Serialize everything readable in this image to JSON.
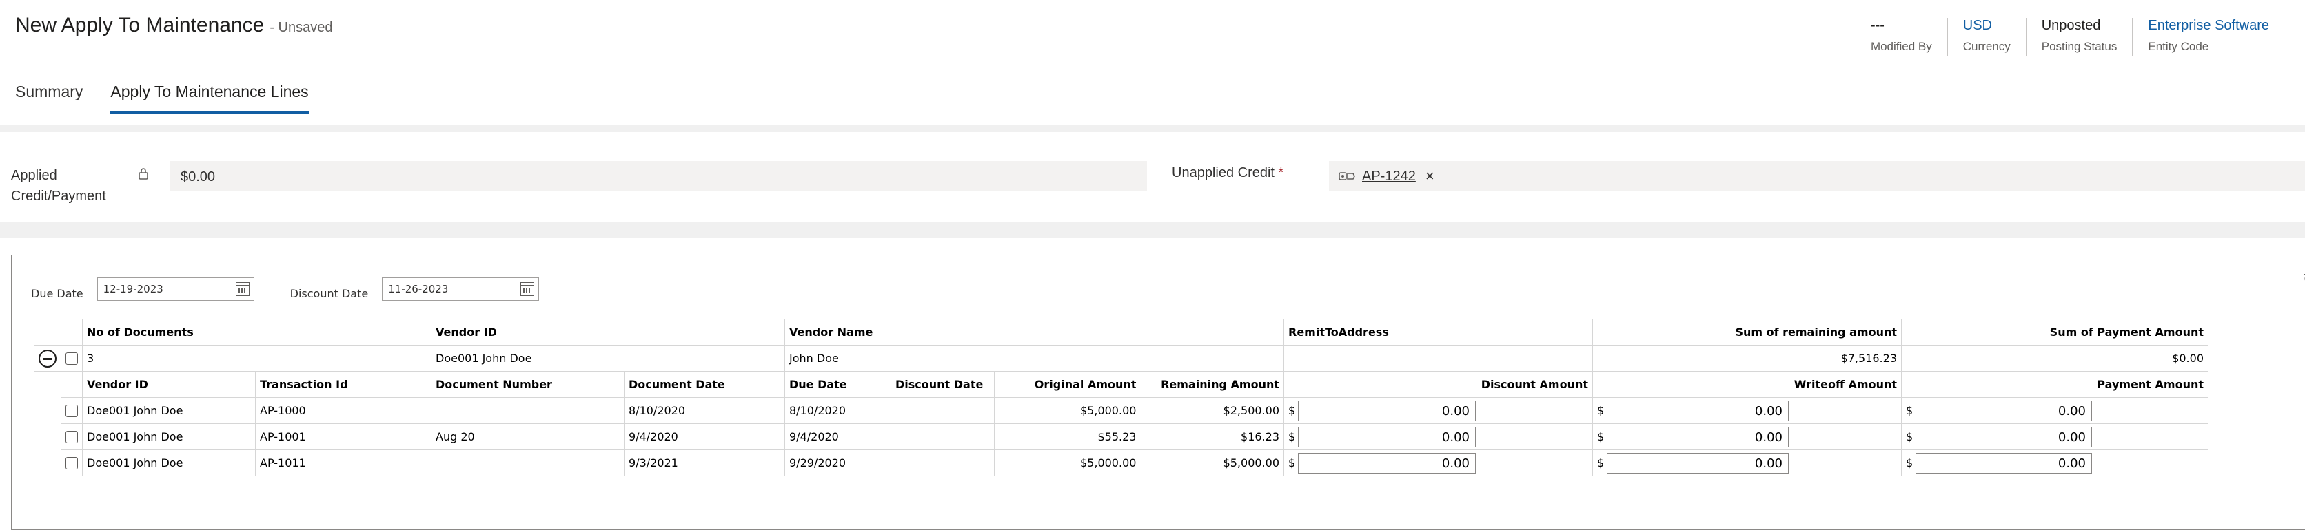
{
  "header": {
    "title": "New Apply To Maintenance",
    "status": "- Unsaved",
    "fields": [
      {
        "value": "---",
        "label": "Modified By",
        "link": false
      },
      {
        "value": "USD",
        "label": "Currency",
        "link": true
      },
      {
        "value": "Unposted",
        "label": "Posting Status",
        "link": false
      },
      {
        "value": "Enterprise Software",
        "label": "Entity Code",
        "link": true
      }
    ]
  },
  "tabs": [
    "Summary",
    "Apply To Maintenance Lines"
  ],
  "form": {
    "applied_label": "Applied Credit/Payment",
    "applied_value": "$0.00",
    "unapplied_label": "Unapplied Credit",
    "required_mark": "*",
    "unapplied_tag": "AP-1242",
    "remove_glyph": "×"
  },
  "filters": {
    "due_date_label": "Due Date",
    "due_date_value": "12-19-2023",
    "discount_date_label": "Discount Date",
    "discount_date_value": "11-26-2023"
  },
  "summary": {
    "headers": [
      "No of Documents",
      "Vendor ID",
      "Vendor Name",
      "RemitToAddress",
      "Sum of remaining amount",
      "Sum of Payment Amount"
    ],
    "row": [
      "3",
      "Doe001 John Doe",
      "John Doe",
      "",
      "$7,516.23",
      "$0.00"
    ]
  },
  "detail": {
    "headers": [
      "Vendor ID",
      "Transaction Id",
      "Document Number",
      "Document Date",
      "Due Date",
      "Discount Date",
      "Original Amount",
      "Remaining Amount",
      "Discount Amount",
      "Writeoff Amount",
      "Payment Amount"
    ],
    "currency_symbol": "$",
    "rows": [
      {
        "vendor": "Doe001 John Doe",
        "txn": "AP-1000",
        "doc": "",
        "doc_date": "8/10/2020",
        "due": "8/10/2020",
        "disc_date": "",
        "orig": "$5,000.00",
        "rem": "$2,500.00",
        "disc": "0.00",
        "writeoff": "0.00",
        "pay": "0.00"
      },
      {
        "vendor": "Doe001 John Doe",
        "txn": "AP-1001",
        "doc": "Aug 20",
        "doc_date": "9/4/2020",
        "due": "9/4/2020",
        "disc_date": "",
        "orig": "$55.23",
        "rem": "$16.23",
        "disc": "0.00",
        "writeoff": "0.00",
        "pay": "0.00"
      },
      {
        "vendor": "Doe001 John Doe",
        "txn": "AP-1011",
        "doc": "",
        "doc_date": "9/3/2021",
        "due": "9/29/2020",
        "disc_date": "",
        "orig": "$5,000.00",
        "rem": "$5,000.00",
        "disc": "0.00",
        "writeoff": "0.00",
        "pay": "0.00"
      }
    ]
  }
}
